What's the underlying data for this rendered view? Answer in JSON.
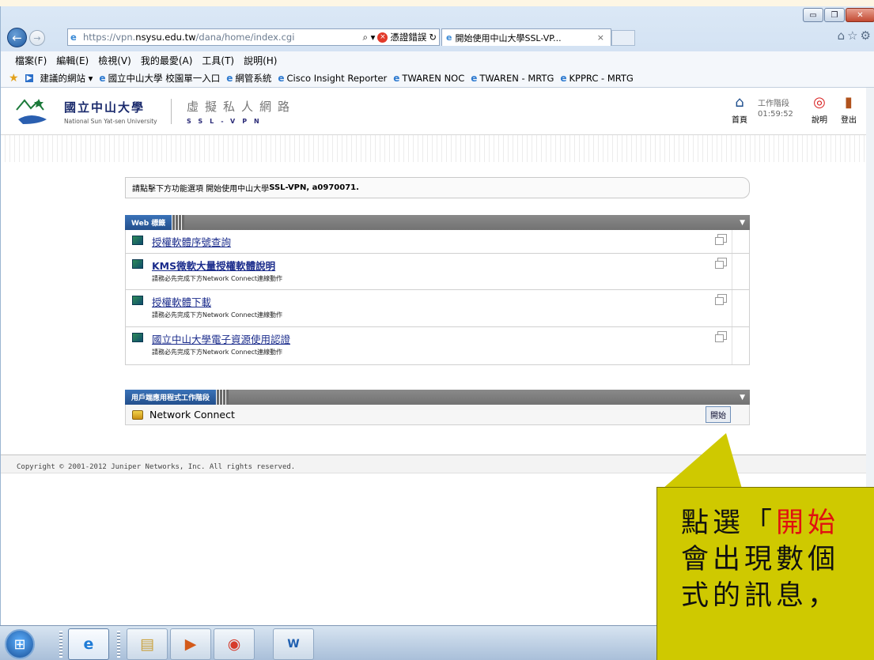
{
  "browser": {
    "url_prefix": "https://vpn.",
    "url_domain": "nsysu.edu.tw",
    "url_path": "/dana/home/index.cgi",
    "search_glyph": "⌕ ▾",
    "cert_error_label": "憑證錯誤",
    "refresh_glyph": "↻",
    "tab_title": "開始使用中山大學SSL-VP...",
    "tab_close": "×",
    "window_buttons": [
      "▭",
      "❐",
      "✕"
    ],
    "toolbar_icons": "⌂☆⚙"
  },
  "menubar": {
    "items": [
      "檔案(F)",
      "編輯(E)",
      "檢視(V)",
      "我的最愛(A)",
      "工具(T)",
      "說明(H)"
    ]
  },
  "favorites": {
    "suggested": "建議的網站 ▾",
    "items": [
      "國立中山大學 校園單一入口",
      "網管系統",
      "Cisco Insight Reporter",
      "TWAREN NOC",
      "TWAREN - MRTG",
      "KPPRC - MRTG"
    ]
  },
  "header": {
    "university_zh": "國立中山大學",
    "university_en": "National Sun Yat-sen University",
    "vpn_zh": "虛擬私人網路",
    "vpn_en": "SSL-VPN",
    "home_label": "首頁",
    "session_label": "工作階段",
    "session_time": "01:59:52",
    "help_label": "說明",
    "logout_label": "登出"
  },
  "welcome": {
    "prefix": "請點擊下方功能選項 開始使用中山大學",
    "bold": "SSL-VPN, a0970071."
  },
  "web_section": {
    "title": "Web 標籤",
    "items": [
      {
        "label": "授權軟體序號查詢",
        "note": ""
      },
      {
        "label": "KMS微軟大量授權軟體說明",
        "note": "請務必先完成下方Network Connect連線動作"
      },
      {
        "label": "授權軟體下載",
        "note": "請務必先完成下方Network Connect連線動作"
      },
      {
        "label": "國立中山大學電子資源使用認證",
        "note": "請務必先完成下方Network Connect連線動作"
      }
    ]
  },
  "client_section": {
    "title": "用戶端應用程式工作階段",
    "item_label": "Network Connect",
    "start_button": "開始"
  },
  "footer": {
    "copyright": "Copyright © 2001-2012 Juniper Networks, Inc. All rights reserved."
  },
  "callout": {
    "line1_a": "點選「",
    "line1_red": "開始",
    "line2": "會出現數個",
    "line3": "式的訊息，"
  },
  "colors": {
    "callout_bg": "#cfc900",
    "highlight_red": "#e01010",
    "link_blue": "#1b2c8c"
  }
}
